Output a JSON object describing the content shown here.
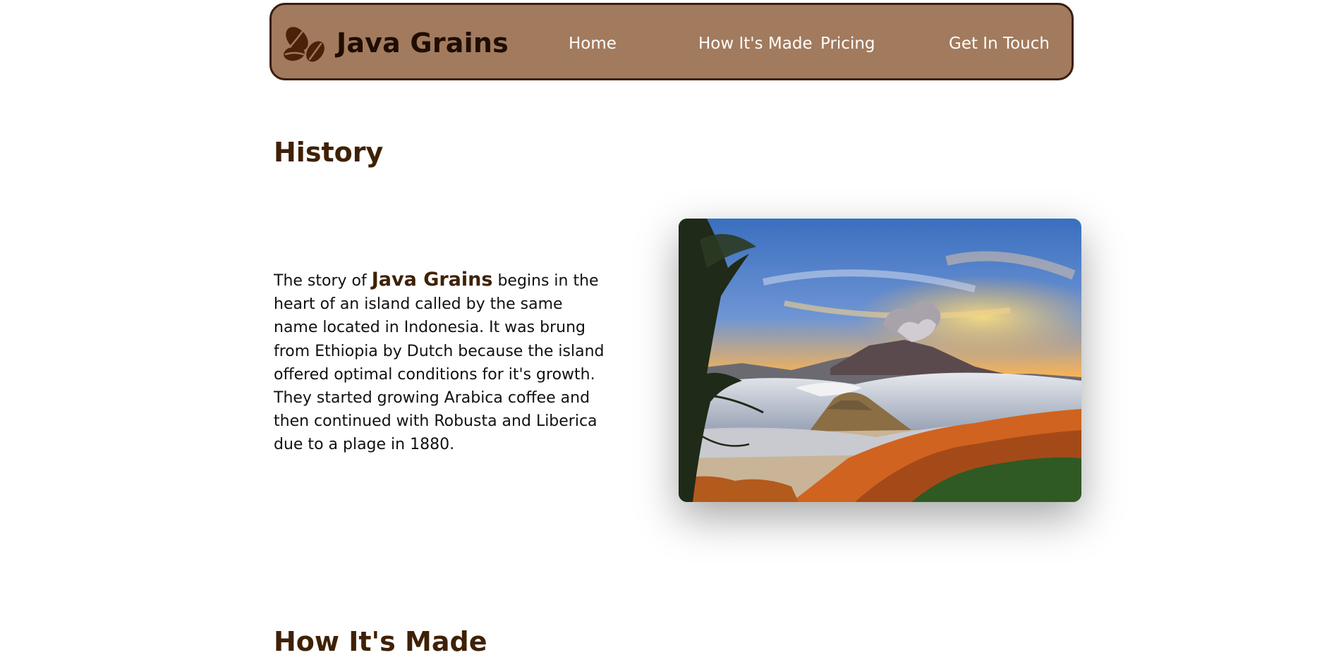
{
  "brand": {
    "name": "Java Grains",
    "logo_icon": "coffee-beans-icon"
  },
  "nav": {
    "items": [
      {
        "label": "Home"
      },
      {
        "label": "How It's Made"
      },
      {
        "label": "Pricing"
      },
      {
        "label": "Get In Touch"
      }
    ]
  },
  "history": {
    "title": "History",
    "story_intro": "The story of ",
    "story_brand": "Java Grains",
    "story_rest": " begins in the heart of an island called by the same name located in Indonesia. It was brung from Ethiopia by Dutch because the island offered optimal conditions for it's growth. They started growing Arabica coffee and then continued with Robusta and Liberica due to a plage in 1880.",
    "image_subject": "volcano-landscape-photo"
  },
  "how_its_made": {
    "title": "How It's Made"
  },
  "colors": {
    "nav_background": "#a27a5d",
    "nav_border": "#3a1e0c",
    "heading": "#3f2105",
    "body_text": "#111111",
    "nav_text": "#ffffff"
  }
}
